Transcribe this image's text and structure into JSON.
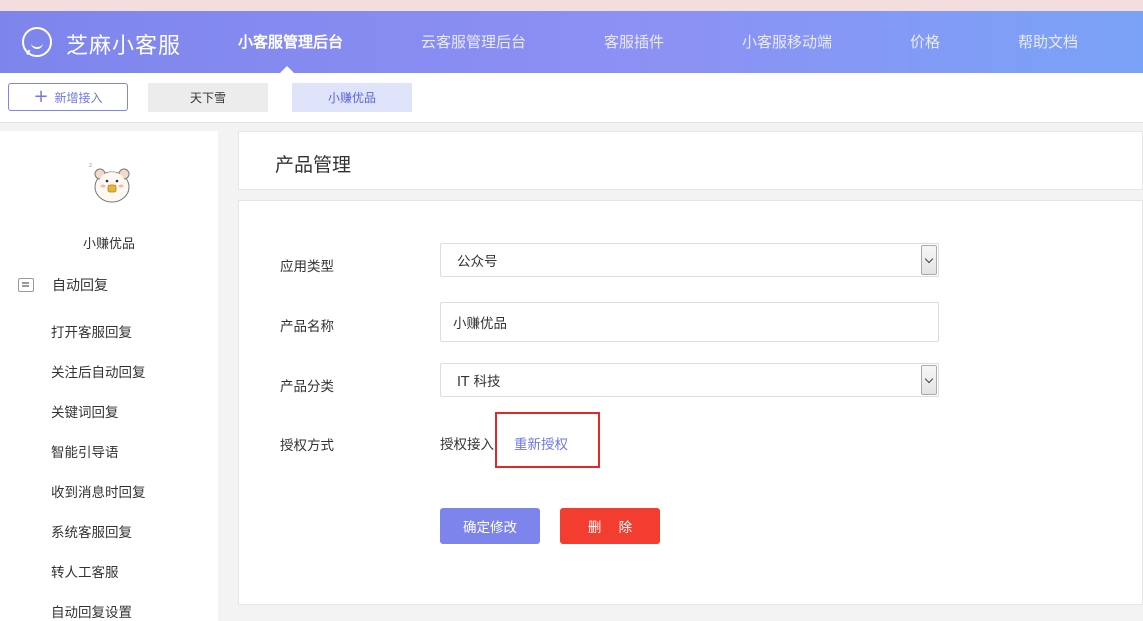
{
  "header": {
    "logo_text": "芝麻小客服",
    "nav": [
      {
        "label": "小客服管理后台",
        "active": true
      },
      {
        "label": "云客服管理后台",
        "active": false
      },
      {
        "label": "客服插件",
        "active": false
      },
      {
        "label": "小客服移动端",
        "active": false
      },
      {
        "label": "价格",
        "active": false
      },
      {
        "label": "帮助文档",
        "active": false
      }
    ]
  },
  "subbar": {
    "add_label": "新增接入",
    "tabs": [
      {
        "label": "天下雪",
        "active": false
      },
      {
        "label": "小赚优品",
        "active": true
      }
    ]
  },
  "sidebar": {
    "shop_name": "小赚优品",
    "menu_title": "自动回复",
    "items": [
      "打开客服回复",
      "关注后自动回复",
      "关键词回复",
      "智能引导语",
      "收到消息时回复",
      "系统客服回复",
      "转人工客服",
      "自动回复设置"
    ]
  },
  "main": {
    "page_title": "产品管理",
    "form": {
      "app_type_label": "应用类型",
      "app_type_value": "公众号",
      "product_name_label": "产品名称",
      "product_name_value": "小赚优品",
      "category_label": "产品分类",
      "category_value": "IT 科技",
      "auth_label": "授权方式",
      "auth_value": "授权接入",
      "reauth_link": "重新授权"
    },
    "confirm_label": "确定修改",
    "delete_label": "删    除"
  },
  "colors": {
    "accent": "#7d85ec",
    "danger": "#f23d30",
    "highlight_box": "#e02a2a"
  }
}
